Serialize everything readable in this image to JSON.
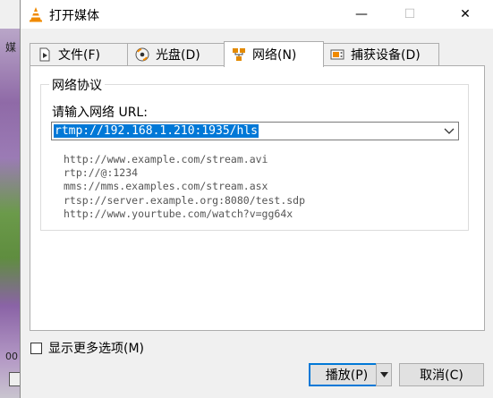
{
  "background": {
    "label": "媒",
    "number": "00"
  },
  "window": {
    "title": "打开媒体"
  },
  "titlebar": {
    "minimize": "—",
    "maximize": "☐",
    "close": "✕"
  },
  "tabs": [
    {
      "label": "文件(F)",
      "icon": "file-icon"
    },
    {
      "label": "光盘(D)",
      "icon": "disc-icon"
    },
    {
      "label": "网络(N)",
      "icon": "network-icon",
      "active": true
    },
    {
      "label": "捕获设备(D)",
      "icon": "capture-device-icon"
    }
  ],
  "network": {
    "group_title": "网络协议",
    "url_label": "请输入网络 URL:",
    "url_value": "rtmp://192.168.1.210:1935/hls",
    "examples": [
      "http://www.example.com/stream.avi",
      "rtp://@:1234",
      "mms://mms.examples.com/stream.asx",
      "rtsp://server.example.org:8080/test.sdp",
      "http://www.yourtube.com/watch?v=gg64x"
    ]
  },
  "footer": {
    "more_options_label": "显示更多选项(M)",
    "more_options_checked": false,
    "play_label": "播放(P)",
    "cancel_label": "取消(C)"
  },
  "colors": {
    "accent": "#0078d7",
    "vlc_orange": "#f08a00"
  }
}
